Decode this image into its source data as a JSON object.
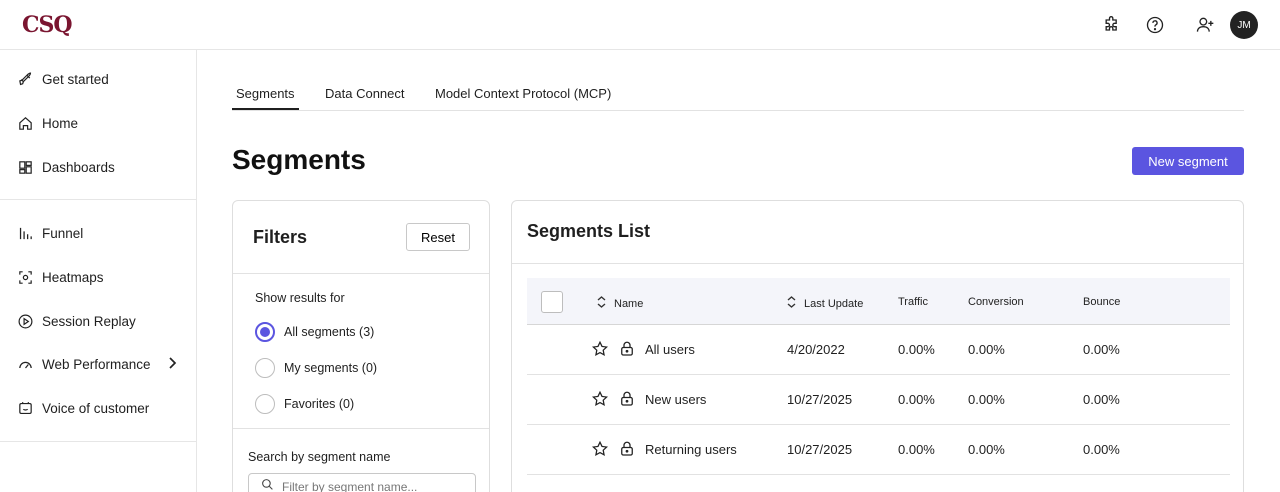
{
  "header": {
    "logo": "CSQ",
    "avatar_initials": "JM",
    "icons": [
      "puzzle-icon",
      "help-icon",
      "add-user-icon"
    ]
  },
  "sidebar": {
    "items": [
      {
        "label": "Get started",
        "icon": "rocket-icon"
      },
      {
        "label": "Home",
        "icon": "home-icon"
      },
      {
        "label": "Dashboards",
        "icon": "dashboards-icon"
      },
      {
        "label": "Funnel",
        "icon": "funnel-icon"
      },
      {
        "label": "Heatmaps",
        "icon": "heatmaps-icon"
      },
      {
        "label": "Session Replay",
        "icon": "play-icon"
      },
      {
        "label": "Web Performance",
        "icon": "gauge-icon"
      },
      {
        "label": "Voice of customer",
        "icon": "feedback-icon"
      }
    ]
  },
  "tabs": [
    {
      "label": "Segments",
      "active": true
    },
    {
      "label": "Data Connect",
      "active": false
    },
    {
      "label": "Model Context Protocol (MCP)",
      "active": false
    }
  ],
  "page": {
    "title": "Segments",
    "new_segment_label": "New segment"
  },
  "filters": {
    "title": "Filters",
    "reset_label": "Reset",
    "show_results_label": "Show results for",
    "options": [
      {
        "label": "All segments (3)",
        "checked": true
      },
      {
        "label": "My segments (0)",
        "checked": false
      },
      {
        "label": "Favorites (0)",
        "checked": false
      }
    ],
    "search_label": "Search by segment name",
    "search_placeholder": "Filter by segment name..."
  },
  "segments_list": {
    "title": "Segments List",
    "columns": [
      "Name",
      "Last Update",
      "Traffic",
      "Conversion",
      "Bounce"
    ],
    "rows": [
      {
        "name": "All users",
        "last_update": "4/20/2022",
        "traffic": "0.00%",
        "conversion": "0.00%",
        "bounce": "0.00%"
      },
      {
        "name": "New users",
        "last_update": "10/27/2025",
        "traffic": "0.00%",
        "conversion": "0.00%",
        "bounce": "0.00%"
      },
      {
        "name": "Returning users",
        "last_update": "10/27/2025",
        "traffic": "0.00%",
        "conversion": "0.00%",
        "bounce": "0.00%"
      }
    ]
  },
  "colors": {
    "brand": "#7a1530",
    "accent": "#5b55e0"
  }
}
